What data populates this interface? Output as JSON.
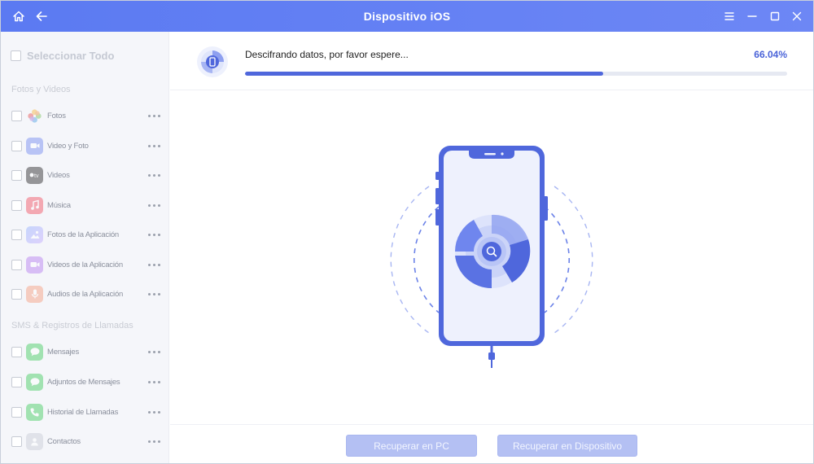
{
  "window": {
    "title": "Dispositivo iOS"
  },
  "sidebar": {
    "select_all_label": "Seleccionar Todo",
    "sections": [
      {
        "title": "Fotos y Videos",
        "items": [
          {
            "label": "Fotos",
            "icon": "photos-icon"
          },
          {
            "label": "Video y Foto",
            "icon": "video-camera-icon"
          },
          {
            "label": "Videos",
            "icon": "apple-tv-icon"
          },
          {
            "label": "Música",
            "icon": "music-note-icon"
          },
          {
            "label": "Fotos de la Aplicación",
            "icon": "app-photos-icon"
          },
          {
            "label": "Videos de la Aplicación",
            "icon": "app-videos-icon"
          },
          {
            "label": "Audios de la Aplicación",
            "icon": "microphone-icon"
          }
        ]
      },
      {
        "title": "SMS & Registros de Llamadas",
        "items": [
          {
            "label": "Mensajes",
            "icon": "messages-icon"
          },
          {
            "label": "Adjuntos de Mensajes",
            "icon": "message-attachments-icon"
          },
          {
            "label": "Historial de Llamadas",
            "icon": "phone-icon"
          },
          {
            "label": "Contactos",
            "icon": "contacts-icon"
          }
        ]
      }
    ]
  },
  "progress": {
    "text": "Descifrando datos, por favor espere...",
    "percent_label": "66.04%",
    "percent": 66.04
  },
  "footer": {
    "recover_pc_label": "Recuperar en PC",
    "recover_device_label": "Recuperar en Dispositivo"
  },
  "colors": {
    "accent": "#4f67dc",
    "titlebar": "#6480f4",
    "button_disabled": "#b4c0f3"
  }
}
